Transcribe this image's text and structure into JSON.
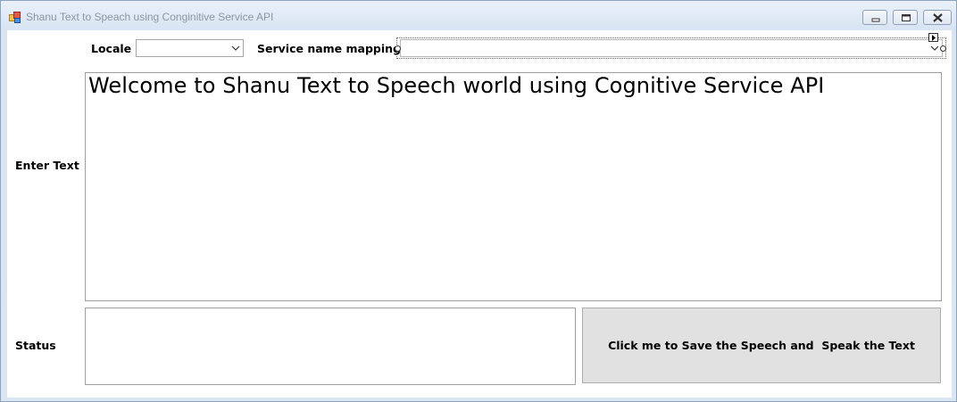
{
  "window": {
    "title": "Shanu Text to Speach using Conginitive Service API"
  },
  "labels": {
    "locale": "Locale",
    "service_name_mapping": "Service name mapping",
    "enter_text": "Enter Text",
    "status": "Status"
  },
  "locale_combo": {
    "value": ""
  },
  "service_combo": {
    "value": ""
  },
  "text_input": {
    "value": "Welcome to Shanu Text to Speech world using Cognitive Service API"
  },
  "status_box": {
    "value": ""
  },
  "action_button": {
    "label": "Click me to Save the Speech and  Speak the Text"
  },
  "icons": {
    "app": "form-app-icon",
    "minimize": "minimize-icon",
    "restore": "restore-icon",
    "close": "close-icon",
    "dropdown": "chevron-down-icon",
    "smart_tag": "smart-tag-arrow-icon"
  }
}
